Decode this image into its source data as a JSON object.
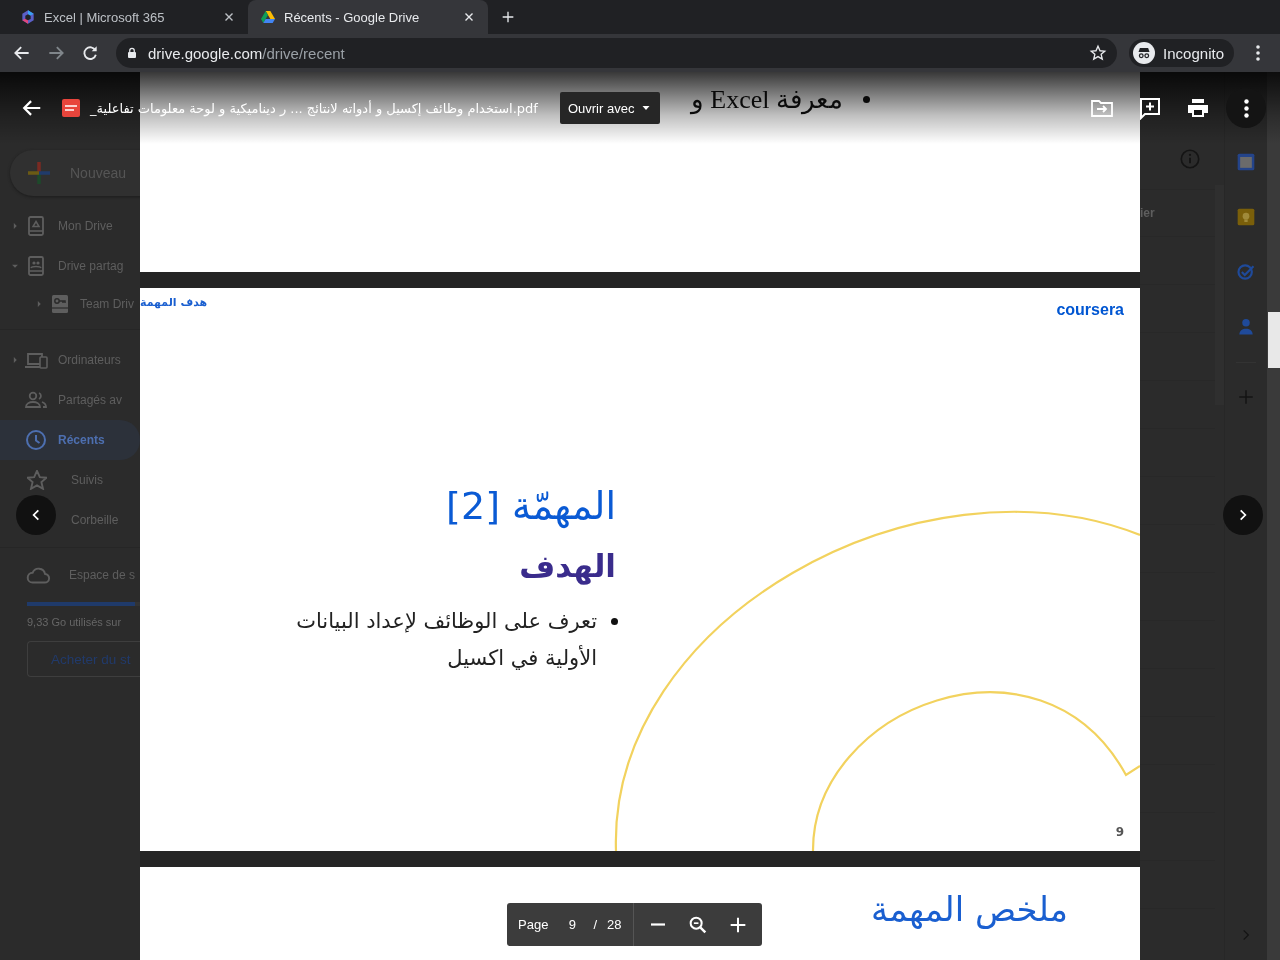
{
  "browser": {
    "tabs": [
      {
        "title": "Excel | Microsoft 365",
        "selected": false
      },
      {
        "title": "Récents - Google Drive",
        "selected": true
      }
    ],
    "nav_buttons": [
      {
        "kind": "back",
        "disabled": false
      },
      {
        "kind": "forward",
        "disabled": true
      },
      {
        "kind": "reload",
        "disabled": false
      }
    ],
    "url": {
      "host": "drive.google.com",
      "path": "/drive/recent"
    },
    "profile": "Incognito"
  },
  "drive": {
    "new_button": "Nouveau",
    "nav_groups": [
      [
        {
          "label": "Mon Drive",
          "kind": "drive",
          "expanded": false,
          "selected": false
        },
        {
          "label": "Drive partag",
          "kind": "shared",
          "expanded": true,
          "selected": false,
          "children": [
            {
              "label": "Team Driv",
              "kind": "team",
              "expanded": false,
              "selected": false
            }
          ]
        }
      ],
      [
        {
          "label": "Ordinateurs",
          "kind": "computers",
          "expanded": false,
          "selected": false
        },
        {
          "label": "Partagés av",
          "kind": "people",
          "selected": false
        },
        {
          "label": "Récents",
          "kind": "clock",
          "selected": true
        },
        {
          "label": "Suivis",
          "kind": "star",
          "selected": false
        },
        {
          "label": "Corbeille",
          "kind": "trash",
          "selected": false
        }
      ]
    ],
    "storage": {
      "label": "Espace de s",
      "level": 0.93,
      "usage": "9,33 Go utilisés sur",
      "buy_button": "Acheter du st"
    },
    "file_list": {
      "column_header": "ier"
    }
  },
  "viewer": {
    "file_name": "_استخدام وظائف إكسيل و أدواته لانتائج ... ر ديناميكية و لوحة معلومات تفاعلية.pdf",
    "open_with": "Ouvrir avec",
    "pages": [
      {
        "kind": "fragment",
        "bullets": [
          "معرفة Excel و"
        ]
      },
      {
        "kind": "slide",
        "header": "هدف المهمة",
        "logo": "coursera",
        "title": "المهمّة [2]",
        "subtitle": "الهدف",
        "bullets": [
          "تعرف على الوظائف لإعداد البيانات الأولية في اكسيل"
        ],
        "number": "9"
      },
      {
        "kind": "title_fragment",
        "title": "ملخص المهمة"
      }
    ],
    "page_bar": {
      "label": "Page",
      "current": "9",
      "separator": "/",
      "total": "28"
    }
  }
}
